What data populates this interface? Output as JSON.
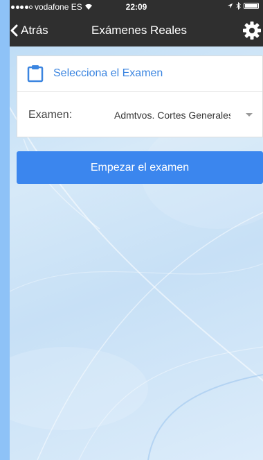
{
  "status_bar": {
    "carrier": "vodafone ES",
    "time": "22:09"
  },
  "nav": {
    "back_label": "Atrás",
    "title": "Exámenes Reales"
  },
  "card": {
    "title": "Selecciona el Examen",
    "field_label": "Examen:",
    "selected_value": "Admtvos. Cortes Generales"
  },
  "start_button": {
    "label": "Empezar el examen"
  },
  "colors": {
    "accent": "#3b86ee",
    "nav_background": "#2f2f2f",
    "card_title": "#3b85e0"
  }
}
